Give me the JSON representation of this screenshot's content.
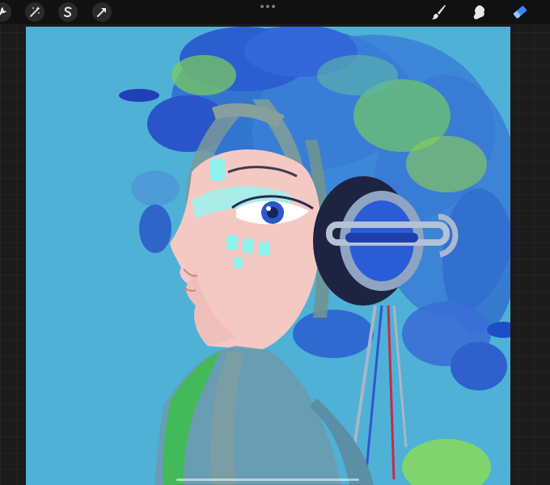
{
  "toolbar": {
    "left_tools": [
      {
        "icon": "wrench-icon"
      },
      {
        "icon": "adjustments-wand-icon"
      },
      {
        "icon": "selection-s-icon"
      },
      {
        "icon": "transform-arrow-icon"
      }
    ],
    "right_tools": [
      {
        "icon": "brush-icon"
      },
      {
        "icon": "smudge-icon"
      },
      {
        "icon": "eraser-icon",
        "active": true
      }
    ],
    "active_color": "#3b86f6"
  },
  "canvas": {
    "background_color": "#4fb1d6"
  }
}
